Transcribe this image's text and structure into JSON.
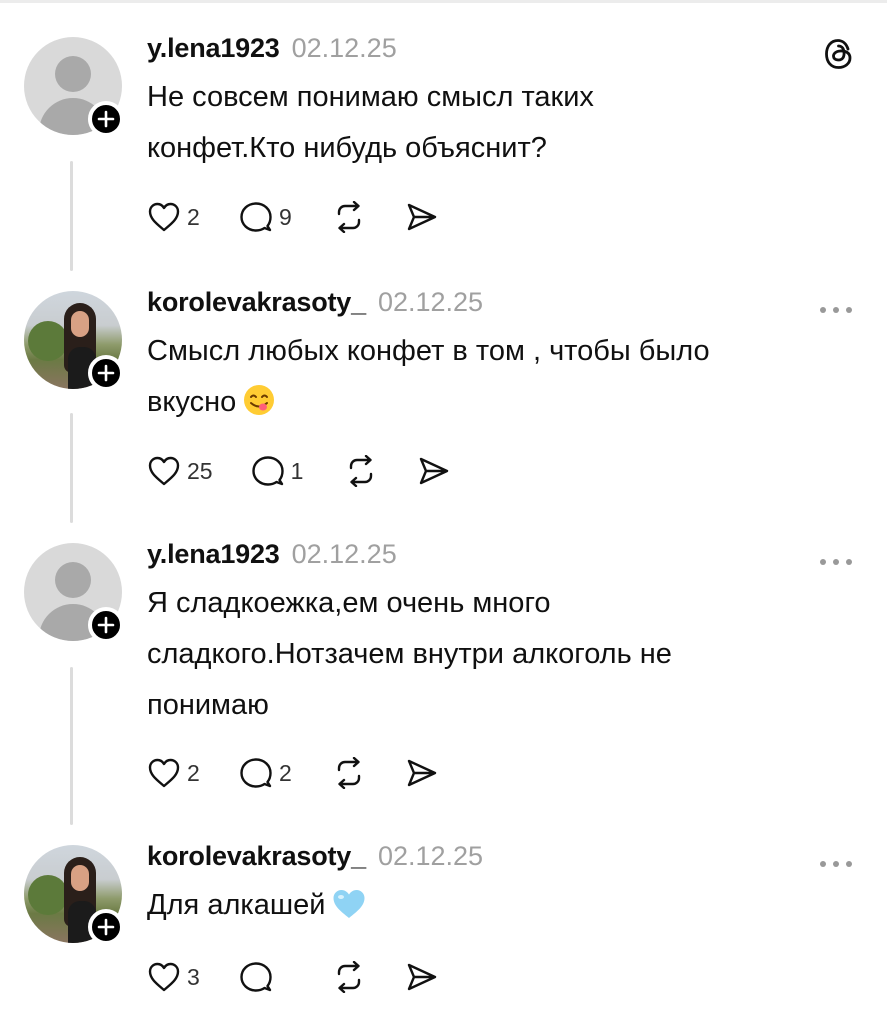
{
  "threads": [
    {
      "username": "y.lena1923",
      "date": "02.12.25",
      "text_lines": [
        "Не совсем понимаю смысл таких",
        "конфет.Кто нибудь объяснит?"
      ],
      "likes": "2",
      "replies": "9",
      "avatar": "default-avatar",
      "corner_icon": "threads-logo-icon"
    },
    {
      "username": "korolevakrasoty_",
      "date": "02.12.25",
      "text_lines": [
        "Смысл любых конфет в том , чтобы было",
        "вкусно"
      ],
      "emoji": "😋",
      "likes": "25",
      "replies": "1",
      "avatar": "photo-avatar",
      "corner_icon": "more-options-icon"
    },
    {
      "username": "y.lena1923",
      "date": "02.12.25",
      "text_lines": [
        "Я сладкоежка,ем очень много",
        "сладкого.Нотзачем внутри алкоголь не",
        "понимаю"
      ],
      "likes": "2",
      "replies": "2",
      "avatar": "default-avatar",
      "corner_icon": "more-options-icon"
    },
    {
      "username": "korolevakrasoty_",
      "date": "02.12.25",
      "text_lines": [
        "Для алкашей"
      ],
      "emoji": "🩵",
      "likes": "3",
      "replies": "",
      "avatar": "photo-avatar",
      "corner_icon": "more-options-icon"
    }
  ],
  "colors": {
    "text": "#101010",
    "muted": "#a0a0a0",
    "thread_line": "#dcdcdc",
    "heart_emoji": "#8fd3f4"
  }
}
